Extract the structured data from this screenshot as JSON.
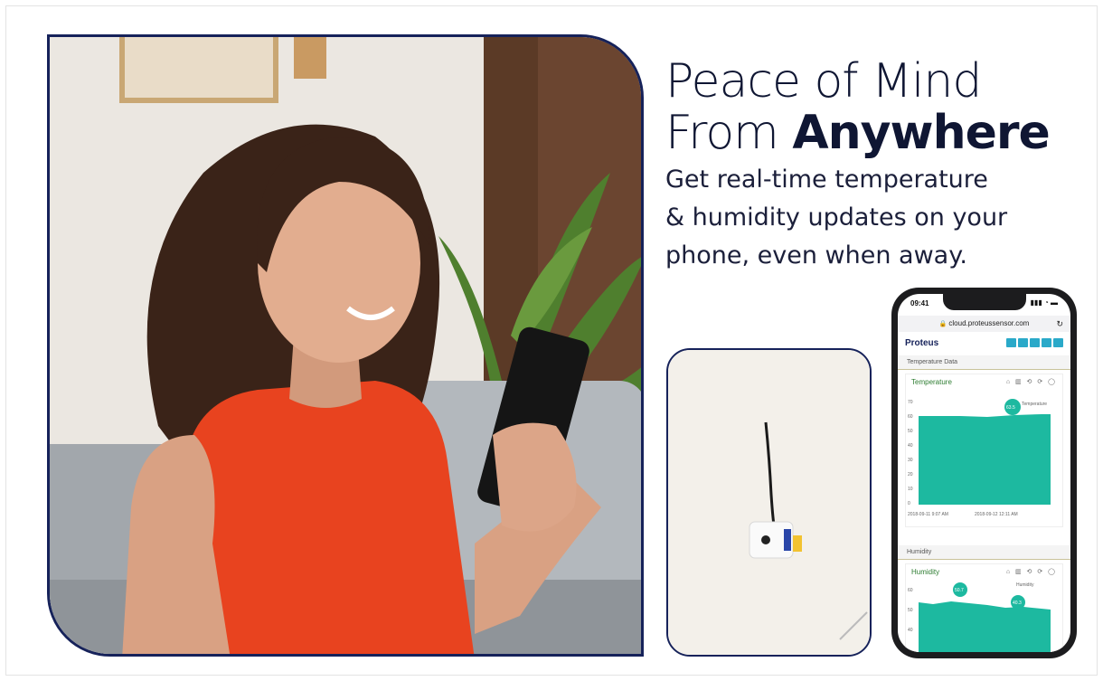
{
  "headline": {
    "line1": "Peace of Mind",
    "line2_light": "From ",
    "line2_bold": "Anywhere",
    "subtext_lines": [
      "Get real-time temperature",
      "& humidity updates on your",
      "phone, even when away."
    ]
  },
  "phone": {
    "time": "09:41",
    "url": "cloud.proteussensor.com",
    "brand": "Proteus",
    "temperature_section": "Temperature Data",
    "temperature_title": "Temperature",
    "temperature_legend": "Temperature",
    "temperature_marker": "63.5",
    "temperature_x_start": "2018-09-11 9:07 AM",
    "temperature_x_end": "2018-09-12 12:11 AM",
    "humidity_section": "Humidity",
    "humidity_title": "Humidity",
    "humidity_legend": "Humidity",
    "humidity_marker_1": "50.7",
    "humidity_marker_2": "40.3",
    "y_ticks_temp": [
      "70",
      "60",
      "50",
      "40",
      "30",
      "20",
      "10",
      "0"
    ],
    "y_ticks_hum": [
      "60",
      "50",
      "40"
    ]
  },
  "colors": {
    "navy": "#16225a",
    "chart_fill": "#1db9a0",
    "accent": "#2aa9c9"
  },
  "images": {
    "hero": "woman-smiling-with-phone-photo",
    "sensor": "wall-mounted-sensor-photo"
  }
}
